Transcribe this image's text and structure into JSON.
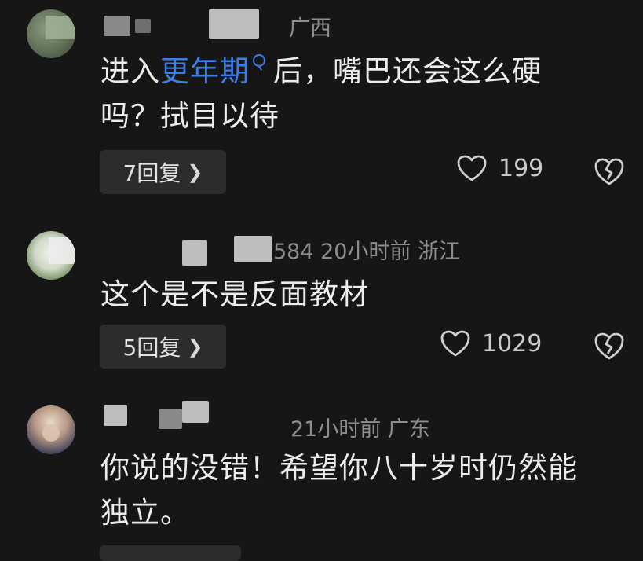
{
  "comments": [
    {
      "meta_tail": "广西",
      "content_pre": "进入",
      "content_link": "更年期",
      "content_post": "后，嘴巴还会这么硬",
      "content_line2": "吗？拭目以待",
      "reply_label": "7回复",
      "likes": "199"
    },
    {
      "meta_tail": "584  20小时前  浙江",
      "content_line1": "这个是不是反面教材",
      "reply_label": "5回复",
      "likes": "1029"
    },
    {
      "meta_tail": "21小时前  广东",
      "content_line1": "你说的没错！希望你八十岁时仍然能",
      "content_line2": "独立。"
    }
  ],
  "icons": {
    "reply_chevron": "chevron-right-icon",
    "like": "heart-icon",
    "dislike": "broken-heart-icon",
    "link_marker": "search-icon"
  },
  "colors": {
    "background": "#161616",
    "link": "#3b7fe6",
    "reply_button": "#2c2c2c"
  }
}
